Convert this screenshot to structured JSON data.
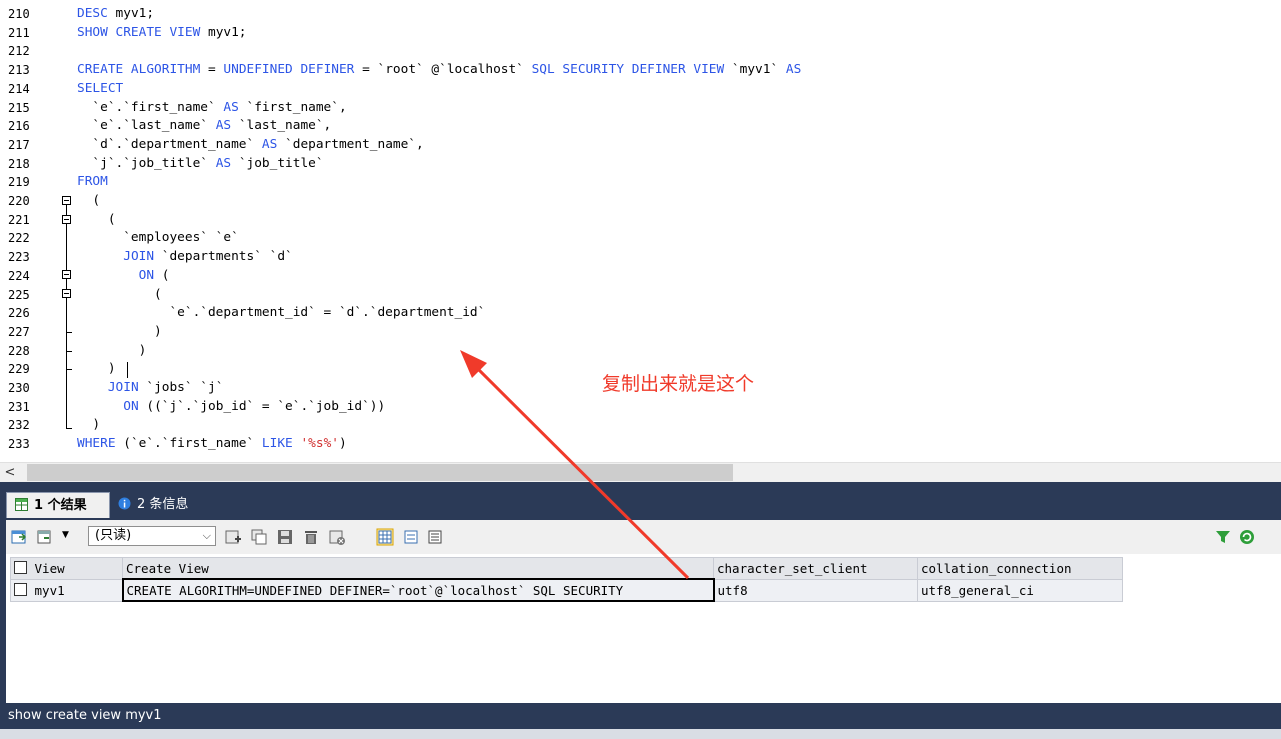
{
  "editor": {
    "lines": [
      {
        "no": "210",
        "code": [
          {
            "t": "DESC",
            "k": "kw"
          },
          {
            "t": " myv1;"
          }
        ]
      },
      {
        "no": "211",
        "code": [
          {
            "t": "SHOW CREATE VIEW",
            "k": "kw"
          },
          {
            "t": " myv1;"
          }
        ]
      },
      {
        "no": "212",
        "code": []
      },
      {
        "no": "213",
        "code": [
          {
            "t": "CREATE ALGORITHM",
            "k": "kw"
          },
          {
            "t": " = "
          },
          {
            "t": "UNDEFINED DEFINER",
            "k": "kw"
          },
          {
            "t": " = `root` @`localhost` "
          },
          {
            "t": "SQL SECURITY DEFINER VIEW",
            "k": "kw"
          },
          {
            "t": " `myv1` "
          },
          {
            "t": "AS",
            "k": "kw"
          }
        ]
      },
      {
        "no": "214",
        "code": [
          {
            "t": "SELECT",
            "k": "kw"
          }
        ]
      },
      {
        "no": "215",
        "code": [
          {
            "t": "  `e`.`first_name` "
          },
          {
            "t": "AS",
            "k": "kw"
          },
          {
            "t": " `first_name`,"
          }
        ]
      },
      {
        "no": "216",
        "code": [
          {
            "t": "  `e`.`last_name` "
          },
          {
            "t": "AS",
            "k": "kw"
          },
          {
            "t": " `last_name`,"
          }
        ]
      },
      {
        "no": "217",
        "code": [
          {
            "t": "  `d`.`department_name` "
          },
          {
            "t": "AS",
            "k": "kw"
          },
          {
            "t": " `department_name`,"
          }
        ]
      },
      {
        "no": "218",
        "code": [
          {
            "t": "  `j`.`job_title` "
          },
          {
            "t": "AS",
            "k": "kw"
          },
          {
            "t": " `job_title`"
          }
        ]
      },
      {
        "no": "219",
        "code": [
          {
            "t": "FROM",
            "k": "kw"
          }
        ]
      },
      {
        "no": "220",
        "code": [
          {
            "t": "  ("
          }
        ]
      },
      {
        "no": "221",
        "code": [
          {
            "t": "    ("
          }
        ]
      },
      {
        "no": "222",
        "code": [
          {
            "t": "      `employees` `e`"
          }
        ]
      },
      {
        "no": "223",
        "code": [
          {
            "t": "      "
          },
          {
            "t": "JOIN",
            "k": "kw"
          },
          {
            "t": " `departments` `d`"
          }
        ]
      },
      {
        "no": "224",
        "code": [
          {
            "t": "        "
          },
          {
            "t": "ON",
            "k": "kw"
          },
          {
            "t": " ("
          }
        ]
      },
      {
        "no": "225",
        "code": [
          {
            "t": "          ("
          }
        ]
      },
      {
        "no": "226",
        "code": [
          {
            "t": "            `e`.`department_id` = `d`.`department_id`"
          }
        ]
      },
      {
        "no": "227",
        "code": [
          {
            "t": "          )"
          }
        ]
      },
      {
        "no": "228",
        "code": [
          {
            "t": "        )"
          }
        ]
      },
      {
        "no": "229",
        "code": [
          {
            "t": "    )"
          }
        ]
      },
      {
        "no": "230",
        "code": [
          {
            "t": "    "
          },
          {
            "t": "JOIN",
            "k": "kw"
          },
          {
            "t": " `jobs` `j`"
          }
        ]
      },
      {
        "no": "231",
        "code": [
          {
            "t": "      "
          },
          {
            "t": "ON",
            "k": "kw"
          },
          {
            "t": " ((`j`.`job_id` = `e`.`job_id`))"
          }
        ]
      },
      {
        "no": "232",
        "code": [
          {
            "t": "  )"
          }
        ]
      },
      {
        "no": "233",
        "code": [
          {
            "t": "WHERE",
            "k": "kw"
          },
          {
            "t": " (`e`.`first_name` "
          },
          {
            "t": "LIKE",
            "k": "kw"
          },
          {
            "t": " "
          },
          {
            "t": "'%s%'",
            "k": "str"
          },
          {
            "t": ")"
          }
        ]
      }
    ]
  },
  "annotation": {
    "text": "复制出来就是这个",
    "color": "#f03a2a"
  },
  "hscroll": {
    "left_arrow": "<"
  },
  "results": {
    "tabs": [
      {
        "label": "1 个结果",
        "icon": "grid-result-icon"
      },
      {
        "label": "2 条信息",
        "icon": "info-icon"
      }
    ],
    "readonly_select": {
      "value": "(只读)"
    },
    "columns": [
      "View",
      "Create View",
      "character_set_client",
      "collation_connection"
    ],
    "rows": [
      [
        "myv1",
        "CREATE ALGORITHM=UNDEFINED DEFINER=`root`@`localhost` SQL SECURITY",
        "utf8",
        "utf8_general_ci"
      ]
    ],
    "status": "show create view myv1"
  },
  "colors": {
    "keyword": "#2d55e6",
    "string": "#d12e2e",
    "panel": "#2b3a57",
    "arrow": "#f03a2a"
  }
}
